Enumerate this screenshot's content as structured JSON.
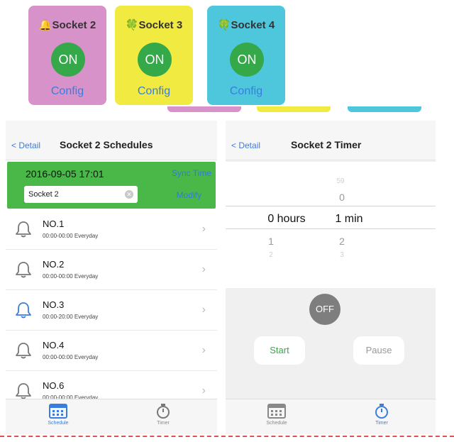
{
  "sockets": [
    {
      "emoji": "🔔",
      "name": "Socket 2",
      "state": "ON",
      "config": "Config",
      "color": "#d792c9"
    },
    {
      "emoji": "🍀",
      "name": "Socket 3",
      "state": "ON",
      "config": "Config",
      "color": "#f1ea41"
    },
    {
      "emoji": "🍀",
      "name": "Socket 4",
      "state": "ON",
      "config": "Config",
      "color": "#4ec7dd"
    }
  ],
  "schedules": {
    "back": "< Detail",
    "title": "Socket 2 Schedules",
    "datetime": "2016-09-05 17:01",
    "sync": "Sync Time",
    "name_value": "Socket 2",
    "modify": "Modify",
    "rows": [
      {
        "label": "NO.1",
        "time": "00:00-00:00 Everyday",
        "active": false
      },
      {
        "label": "NO.2",
        "time": "00:00-00:00 Everyday",
        "active": false
      },
      {
        "label": "NO.3",
        "time": "00:00-20:00 Everyday",
        "active": true
      },
      {
        "label": "NO.4",
        "time": "00:00-00:00 Everyday",
        "active": false
      },
      {
        "label": "NO.6",
        "time": "00:00-00:00 Everyday",
        "active": false
      }
    ],
    "tab_schedule": "Schedule",
    "tab_timer": "Timer"
  },
  "timer": {
    "back": "< Detail",
    "title": "Socket 2 Timer",
    "hours_label": "0 hours",
    "min_label": "1 min",
    "min_above_far": "59",
    "min_above": "0",
    "hour_below": "1",
    "hour_below_far": "2",
    "min_below": "2",
    "min_below_far": "3",
    "off": "OFF",
    "start": "Start",
    "pause": "Pause",
    "tab_schedule": "Schedule",
    "tab_timer": "Timer"
  },
  "colors": {
    "accent_blue": "#3a7de0",
    "green": "#49b849",
    "on_green": "#35a84a"
  }
}
